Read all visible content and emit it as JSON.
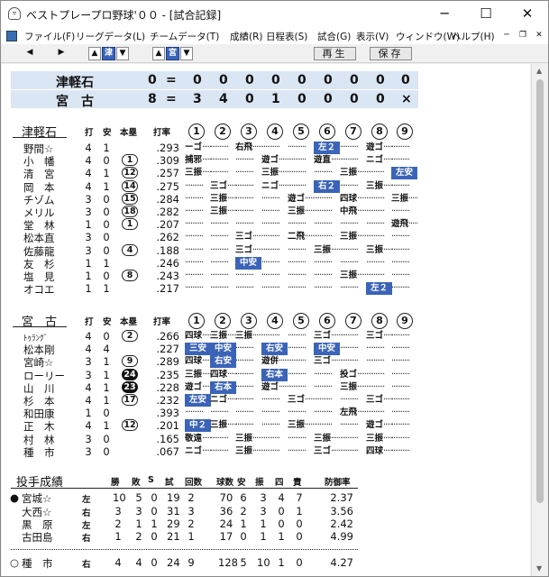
{
  "window": {
    "title": "ベストプレープロ野球'００ - [試合記録]"
  },
  "menu": [
    "ファイル(F)",
    "リーグデータ(L)",
    "チームデータ(T)",
    "成績(R)",
    "日程表(S)",
    "試合(G)",
    "表示(V)",
    "ウィンドウ(W)",
    "ヘルプ(H)"
  ],
  "toolbar": {
    "team1": "津",
    "team2": "宮",
    "replay": "再生",
    "save": "保存"
  },
  "scoreboard": [
    {
      "team": "津軽石",
      "runs": "0",
      "innings": [
        "0",
        "0",
        "0",
        "0",
        "0",
        "0",
        "0",
        "0",
        "0"
      ]
    },
    {
      "team": "宮　古",
      "runs": "8",
      "innings": [
        "3",
        "4",
        "0",
        "1",
        "0",
        "0",
        "0",
        "0",
        "×"
      ]
    }
  ],
  "batting_headers": {
    "ab": "打",
    "h": "安",
    "hr": "本塁",
    "avg": "打率",
    "innings": [
      "1",
      "2",
      "3",
      "4",
      "5",
      "6",
      "7",
      "8",
      "9"
    ]
  },
  "teams": [
    {
      "name": "津軽石",
      "players": [
        {
          "name": "野間☆",
          "ab": "4",
          "h": "1",
          "hr": "",
          "avg": ".293",
          "innings": [
            "ーゴ",
            "",
            "右飛",
            "",
            "",
            "左２",
            "",
            "遊ゴ",
            ""
          ]
        },
        {
          "name": "小　幡",
          "ab": "4",
          "h": "0",
          "hr": "1",
          "avg": ".309",
          "innings": [
            "捕邪",
            "",
            "",
            "遊ゴ",
            "",
            "遊直",
            "",
            "ニゴ",
            ""
          ]
        },
        {
          "name": "清　宮",
          "ab": "4",
          "h": "1",
          "hr": "12",
          "avg": ".257",
          "innings": [
            "三振",
            "",
            "",
            "三振",
            "",
            "",
            "三振",
            "",
            "左安"
          ]
        },
        {
          "name": "岡　本",
          "ab": "4",
          "h": "1",
          "hr": "14",
          "avg": ".275",
          "innings": [
            "",
            "三ゴ",
            "",
            "ニゴ",
            "",
            "右２",
            "",
            "三振",
            ""
          ]
        },
        {
          "name": "チゾム",
          "ab": "3",
          "h": "0",
          "hr": "15",
          "avg": ".284",
          "innings": [
            "",
            "三振",
            "",
            "",
            "遊ゴ",
            "",
            "四球",
            "",
            "三振"
          ]
        },
        {
          "name": "メリル",
          "ab": "3",
          "h": "0",
          "hr": "18",
          "avg": ".282",
          "innings": [
            "",
            "三振",
            "",
            "",
            "三振",
            "",
            "中飛",
            "",
            ""
          ]
        },
        {
          "name": "堂　林",
          "ab": "1",
          "h": "0",
          "hr": "1",
          "avg": ".207",
          "innings": [
            "",
            "",
            "",
            "",
            "",
            "",
            "",
            "",
            "遊飛"
          ]
        },
        {
          "name": "松本直",
          "ab": "3",
          "h": "0",
          "hr": "",
          "avg": ".262",
          "innings": [
            "",
            "",
            "三ゴ",
            "",
            "二飛",
            "",
            "三振",
            "",
            ""
          ]
        },
        {
          "name": "佐藤龍",
          "ab": "3",
          "h": "0",
          "hr": "4",
          "avg": ".188",
          "innings": [
            "",
            "",
            "三ゴ",
            "",
            "",
            "三振",
            "",
            "三振",
            ""
          ]
        },
        {
          "name": "友　杉",
          "ab": "1",
          "h": "1",
          "hr": "",
          "avg": ".246",
          "innings": [
            "",
            "",
            "中安",
            "",
            "",
            "",
            "",
            "",
            ""
          ]
        },
        {
          "name": "塩　見",
          "ab": "1",
          "h": "0",
          "hr": "8",
          "avg": ".243",
          "innings": [
            "",
            "",
            "",
            "",
            "",
            "",
            "三振",
            "",
            ""
          ]
        },
        {
          "name": "オコエ",
          "ab": "1",
          "h": "1",
          "hr": "",
          "avg": ".217",
          "innings": [
            "",
            "",
            "",
            "",
            "",
            "",
            "",
            "左２",
            ""
          ]
        }
      ]
    },
    {
      "name": "宮　古",
      "players": [
        {
          "name": "ﾄｩﾗﾝｸﾞ",
          "ab": "4",
          "h": "0",
          "hr": "2",
          "avg": ".266",
          "innings": [
            "四球",
            "三振",
            "三振",
            "",
            "",
            "三ゴ",
            "",
            "三ゴ",
            ""
          ]
        },
        {
          "name": "松本剛",
          "ab": "4",
          "h": "4",
          "hr": "",
          "avg": ".227",
          "innings": [
            "三安",
            "中安",
            "",
            "右安",
            "",
            "中安",
            "",
            "",
            ""
          ]
        },
        {
          "name": "宮崎☆",
          "ab": "3",
          "h": "1",
          "hr": "9",
          "avg": ".289",
          "innings": [
            "四球",
            "右安",
            "",
            "遊併",
            "",
            "三ゴ",
            "",
            "",
            ""
          ]
        },
        {
          "name": "ローリー",
          "ab": "3",
          "h": "1",
          "hr": "24",
          "avg": ".235",
          "innings": [
            "三振",
            "四球",
            "",
            "右本",
            "",
            "",
            "投ゴ",
            "",
            ""
          ]
        },
        {
          "name": "山　川",
          "ab": "4",
          "h": "1",
          "hr": "23",
          "avg": ".228",
          "innings": [
            "遊ゴ",
            "右本",
            "",
            "遊ゴ",
            "",
            "",
            "三振",
            "",
            ""
          ]
        },
        {
          "name": "杉　本",
          "ab": "4",
          "h": "1",
          "hr": "17",
          "avg": ".232",
          "innings": [
            "左安",
            "ニゴ",
            "",
            "",
            "三ゴ",
            "",
            "",
            "三ゴ",
            ""
          ]
        },
        {
          "name": "和田康",
          "ab": "1",
          "h": "0",
          "hr": "",
          "avg": ".393",
          "innings": [
            "",
            "",
            "",
            "",
            "",
            "",
            "左飛",
            "",
            ""
          ]
        },
        {
          "name": "正　木",
          "ab": "4",
          "h": "1",
          "hr": "12",
          "avg": ".201",
          "innings": [
            "中２",
            "三振",
            "",
            "",
            "三振",
            "",
            "",
            "遊ゴ",
            ""
          ]
        },
        {
          "name": "村　林",
          "ab": "3",
          "h": "0",
          "hr": "",
          "avg": ".165",
          "innings": [
            "敬遠",
            "",
            "三振",
            "",
            "",
            "三振",
            "",
            "三振",
            ""
          ]
        },
        {
          "name": "種　市",
          "ab": "3",
          "h": "0",
          "hr": "",
          "avg": ".067",
          "innings": [
            "ニゴ",
            "",
            "三振",
            "",
            "",
            "三ゴ",
            "",
            "四球",
            ""
          ]
        }
      ]
    }
  ],
  "pitching": {
    "title": "投手成績",
    "headers": [
      "勝",
      "敗",
      "S",
      "試",
      "回数",
      "球数",
      "安",
      "振",
      "四",
      "責",
      "防御率"
    ],
    "rows": [
      {
        "mark": "●",
        "name": "宮城☆",
        "hand": "左",
        "vals": [
          "10",
          "5",
          "0",
          "19",
          "2",
          "70",
          "6",
          "3",
          "4",
          "7",
          "2.37"
        ]
      },
      {
        "mark": "",
        "name": "大西☆",
        "hand": "右",
        "vals": [
          "3",
          "3",
          "0",
          "31",
          "3",
          "36",
          "2",
          "3",
          "0",
          "1",
          "3.56"
        ]
      },
      {
        "mark": "",
        "name": "黒　原",
        "hand": "左",
        "vals": [
          "2",
          "1",
          "1",
          "29",
          "2",
          "24",
          "1",
          "1",
          "0",
          "0",
          "2.42"
        ]
      },
      {
        "mark": "",
        "name": "古田島",
        "hand": "右",
        "vals": [
          "1",
          "2",
          "0",
          "21",
          "1",
          "17",
          "0",
          "1",
          "1",
          "0",
          "4.99"
        ]
      },
      {
        "mark": "○",
        "name": "種　市",
        "hand": "右",
        "vals": [
          "4",
          "4",
          "0",
          "24",
          "9",
          "128",
          "5",
          "10",
          "1",
          "0",
          "4.27"
        ]
      }
    ]
  },
  "colors": {
    "accent": "#3b64b8",
    "score_bg": "#dbe6f4"
  }
}
